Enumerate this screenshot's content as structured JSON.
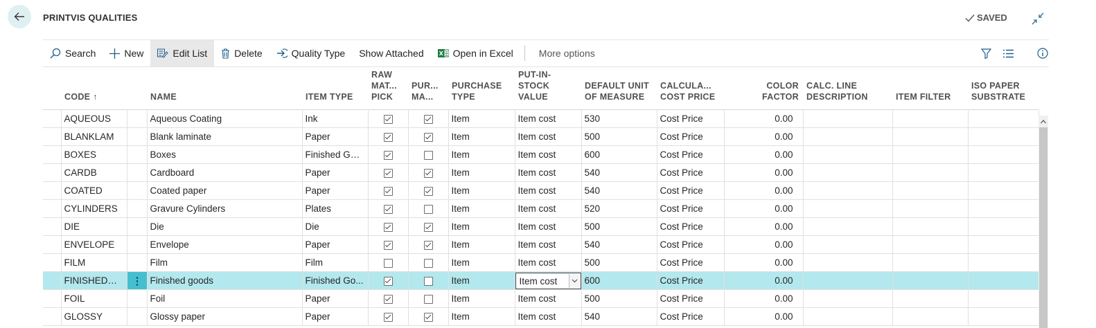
{
  "header": {
    "title": "PRINTVIS QUALITIES",
    "saved_label": "SAVED"
  },
  "toolbar": {
    "search": "Search",
    "new": "New",
    "edit_list": "Edit List",
    "delete": "Delete",
    "quality_type": "Quality Type",
    "show_attached": "Show Attached",
    "open_excel": "Open in Excel",
    "more_options": "More options"
  },
  "columns": {
    "code": "CODE ↑",
    "name": "NAME",
    "item_type": "ITEM TYPE",
    "raw_mat_pick": "RAW MAT... PICK",
    "pur_ma": "PUR... MA...",
    "purchase_type": "PURCHASE TYPE",
    "put_in_stock": "PUT-IN-STOCK VALUE",
    "default_uom": "DEFAULT UNIT OF MEASURE",
    "calc_cost_price": "CALCULA... COST PRICE",
    "color_factor": "COLOR FACTOR",
    "calc_line_desc": "CALC. LINE DESCRIPTION",
    "item_filter": "ITEM FILTER",
    "iso_paper": "ISO PAPER SUBSTRATE"
  },
  "rows": [
    {
      "code": "AQUEOUS",
      "name": "Aqueous Coating",
      "item_type": "Ink",
      "raw": true,
      "pur": true,
      "purchase_type": "Item",
      "put_in_stock": "Item cost",
      "uom": "530",
      "cost": "Cost Price",
      "color_factor": "0.00"
    },
    {
      "code": "BLANKLAM",
      "name": "Blank laminate",
      "item_type": "Paper",
      "raw": true,
      "pur": true,
      "purchase_type": "Item",
      "put_in_stock": "Item cost",
      "uom": "500",
      "cost": "Cost Price",
      "color_factor": "0.00"
    },
    {
      "code": "BOXES",
      "name": "Boxes",
      "item_type": "Finished Good",
      "raw": true,
      "pur": false,
      "purchase_type": "Item",
      "put_in_stock": "Item cost",
      "uom": "600",
      "cost": "Cost Price",
      "color_factor": "0.00"
    },
    {
      "code": "CARDB",
      "name": "Cardboard",
      "item_type": "Paper",
      "raw": true,
      "pur": true,
      "purchase_type": "Item",
      "put_in_stock": "Item cost",
      "uom": "540",
      "cost": "Cost Price",
      "color_factor": "0.00"
    },
    {
      "code": "COATED",
      "name": "Coated paper",
      "item_type": "Paper",
      "raw": true,
      "pur": true,
      "purchase_type": "Item",
      "put_in_stock": "Item cost",
      "uom": "540",
      "cost": "Cost Price",
      "color_factor": "0.00"
    },
    {
      "code": "CYLINDERS",
      "name": "Gravure Cylinders",
      "item_type": "Plates",
      "raw": true,
      "pur": false,
      "purchase_type": "Item",
      "put_in_stock": "Item cost",
      "uom": "520",
      "cost": "Cost Price",
      "color_factor": "0.00"
    },
    {
      "code": "DIE",
      "name": "Die",
      "item_type": "Die",
      "raw": true,
      "pur": true,
      "purchase_type": "Item",
      "put_in_stock": "Item cost",
      "uom": "500",
      "cost": "Cost Price",
      "color_factor": "0.00"
    },
    {
      "code": "ENVELOPE",
      "name": "Envelope",
      "item_type": "Paper",
      "raw": true,
      "pur": true,
      "purchase_type": "Item",
      "put_in_stock": "Item cost",
      "uom": "540",
      "cost": "Cost Price",
      "color_factor": "0.00"
    },
    {
      "code": "FILM",
      "name": "Film",
      "item_type": "Film",
      "raw": false,
      "pur": false,
      "purchase_type": "Item",
      "put_in_stock": "Item cost",
      "uom": "500",
      "cost": "Cost Price",
      "color_factor": "0.00"
    },
    {
      "code": "FINISHEDGO...",
      "name": "Finished goods",
      "item_type": "Finished Go...",
      "raw": true,
      "pur": false,
      "purchase_type": "Item",
      "put_in_stock": "Item cost",
      "uom": "600",
      "cost": "Cost Price",
      "color_factor": "0.00",
      "selected": true
    },
    {
      "code": "FOIL",
      "name": "Foil",
      "item_type": "Paper",
      "raw": true,
      "pur": false,
      "purchase_type": "Item",
      "put_in_stock": "Item cost",
      "uom": "500",
      "cost": "Cost Price",
      "color_factor": "0.00"
    },
    {
      "code": "GLOSSY",
      "name": "Glossy paper",
      "item_type": "Paper",
      "raw": true,
      "pur": true,
      "purchase_type": "Item",
      "put_in_stock": "Item cost",
      "uom": "540",
      "cost": "Cost Price",
      "color_factor": "0.00"
    }
  ]
}
